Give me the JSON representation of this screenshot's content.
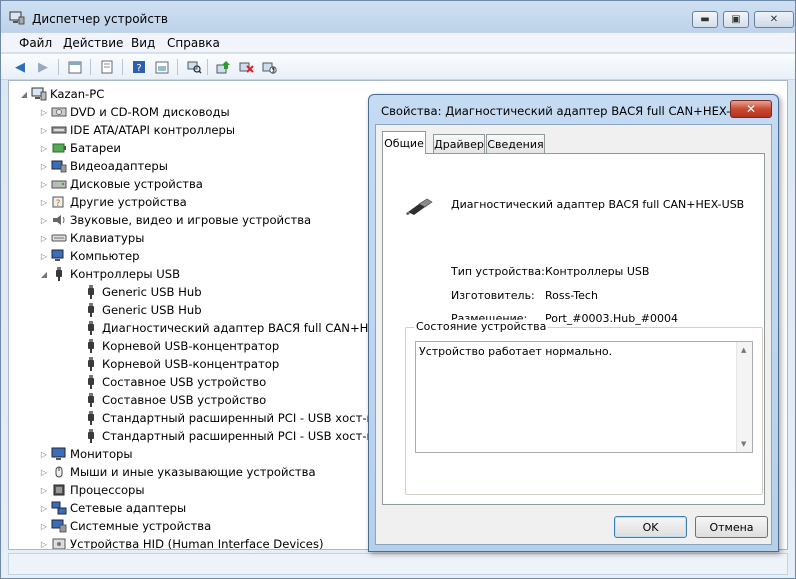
{
  "window": {
    "title": "Диспетчер устройств"
  },
  "menu": [
    "Файл",
    "Действие",
    "Вид",
    "Справка"
  ],
  "toolbar": {
    "icons": [
      "back-icon",
      "forward-icon",
      "up-icon",
      "properties-icon",
      "help-icon",
      "show-hide-icon",
      "scan-hardware-icon",
      "update-driver-icon",
      "uninstall-icon",
      "disable-icon"
    ]
  },
  "tree": {
    "root": "Kazan-PC",
    "items": [
      {
        "label": "DVD и CD-ROM дисководы",
        "level": 1,
        "expander": "▷",
        "icon": "dvd-icon"
      },
      {
        "label": "IDE ATA/ATAPI контроллеры",
        "level": 1,
        "expander": "▷",
        "icon": "ide-icon"
      },
      {
        "label": "Батареи",
        "level": 1,
        "expander": "▷",
        "icon": "battery-icon"
      },
      {
        "label": "Видеоадаптеры",
        "level": 1,
        "expander": "▷",
        "icon": "display-adapter-icon"
      },
      {
        "label": "Дисковые устройства",
        "level": 1,
        "expander": "▷",
        "icon": "disk-icon"
      },
      {
        "label": "Другие устройства",
        "level": 1,
        "expander": "▷",
        "icon": "unknown-device-icon"
      },
      {
        "label": "Звуковые, видео и игровые устройства",
        "level": 1,
        "expander": "▷",
        "icon": "sound-icon"
      },
      {
        "label": "Клавиатуры",
        "level": 1,
        "expander": "▷",
        "icon": "keyboard-icon"
      },
      {
        "label": "Компьютер",
        "level": 1,
        "expander": "▷",
        "icon": "computer-icon"
      },
      {
        "label": "Контроллеры USB",
        "level": 1,
        "expander": "◢",
        "icon": "usb-icon"
      },
      {
        "label": "Generic USB Hub",
        "level": 2,
        "expander": "",
        "icon": "usb-icon"
      },
      {
        "label": "Generic USB Hub",
        "level": 2,
        "expander": "",
        "icon": "usb-icon"
      },
      {
        "label": "Диагностический адаптер ВАСЯ full CAN+HEX-USB",
        "level": 2,
        "expander": "",
        "icon": "usb-icon"
      },
      {
        "label": "Корневой USB-концентратор",
        "level": 2,
        "expander": "",
        "icon": "usb-icon"
      },
      {
        "label": "Корневой USB-концентратор",
        "level": 2,
        "expander": "",
        "icon": "usb-icon"
      },
      {
        "label": "Составное USB устройство",
        "level": 2,
        "expander": "",
        "icon": "usb-icon"
      },
      {
        "label": "Составное USB устройство",
        "level": 2,
        "expander": "",
        "icon": "usb-icon"
      },
      {
        "label": "Стандартный расширенный PCI - USB хост-контроллер",
        "level": 2,
        "expander": "",
        "icon": "usb-icon"
      },
      {
        "label": "Стандартный расширенный PCI - USB хост-контроллер",
        "level": 2,
        "expander": "",
        "icon": "usb-icon"
      },
      {
        "label": "Мониторы",
        "level": 1,
        "expander": "▷",
        "icon": "monitor-icon"
      },
      {
        "label": "Мыши и иные указывающие устройства",
        "level": 1,
        "expander": "▷",
        "icon": "mouse-icon"
      },
      {
        "label": "Процессоры",
        "level": 1,
        "expander": "▷",
        "icon": "processor-icon"
      },
      {
        "label": "Сетевые адаптеры",
        "level": 1,
        "expander": "▷",
        "icon": "network-icon"
      },
      {
        "label": "Системные устройства",
        "level": 1,
        "expander": "▷",
        "icon": "system-icon"
      },
      {
        "label": "Устройства HID (Human Interface Devices)",
        "level": 1,
        "expander": "▷",
        "icon": "hid-icon"
      }
    ]
  },
  "dialog": {
    "title": "Свойства: Диагностический адаптер ВАСЯ full CAN+HEX-USB",
    "close_label": "✕",
    "tabs": [
      "Общие",
      "Драйвер",
      "Сведения"
    ],
    "device_name": "Диагностический адаптер ВАСЯ full CAN+HEX-USB",
    "properties": [
      {
        "label": "Тип устройства:",
        "value": "Контроллеры USB"
      },
      {
        "label": "Изготовитель:",
        "value": "Ross-Tech"
      },
      {
        "label": "Размещение:",
        "value": "Port_#0003.Hub_#0004"
      }
    ],
    "status_group_label": "Состояние устройства",
    "status_text": "Устройство работает нормально.",
    "ok_label": "OK",
    "cancel_label": "Отмена"
  },
  "colors": {
    "usb_icon": "#3a3a3a",
    "dialog_close": "#c84a32",
    "title_bg": "#c4dbf2"
  }
}
